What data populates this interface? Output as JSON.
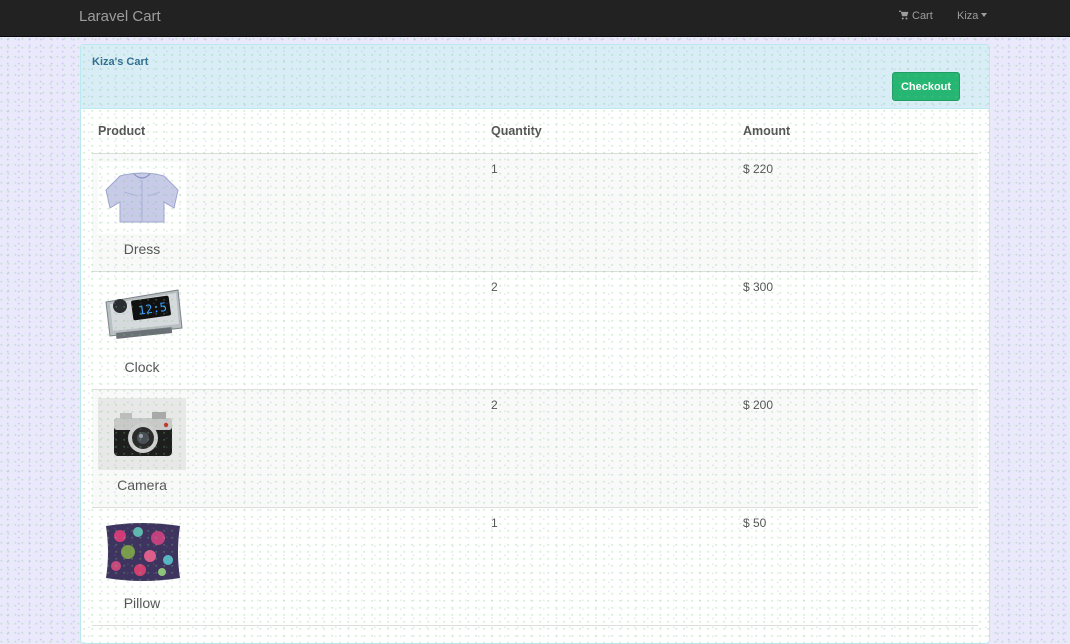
{
  "navbar": {
    "brand": "Laravel Cart",
    "cart_label": "Cart",
    "user_label": "Kiza"
  },
  "panel": {
    "title": "Kiza's Cart",
    "checkout_label": "Checkout"
  },
  "table": {
    "headers": {
      "product": "Product",
      "quantity": "Quantity",
      "amount": "Amount"
    },
    "rows": [
      {
        "name": "Dress",
        "quantity": "1",
        "amount": "$ 220",
        "image": "dress-image"
      },
      {
        "name": "Clock",
        "quantity": "2",
        "amount": "$ 300",
        "image": "clock-image"
      },
      {
        "name": "Camera",
        "quantity": "2",
        "amount": "$ 200",
        "image": "camera-image"
      },
      {
        "name": "Pillow",
        "quantity": "1",
        "amount": "$ 50",
        "image": "pillow-image"
      }
    ]
  },
  "colors": {
    "navbar_bg": "#222222",
    "panel_heading_bg": "#d9edf7",
    "checkout_green": "#26b673",
    "title_blue": "#31708f"
  }
}
